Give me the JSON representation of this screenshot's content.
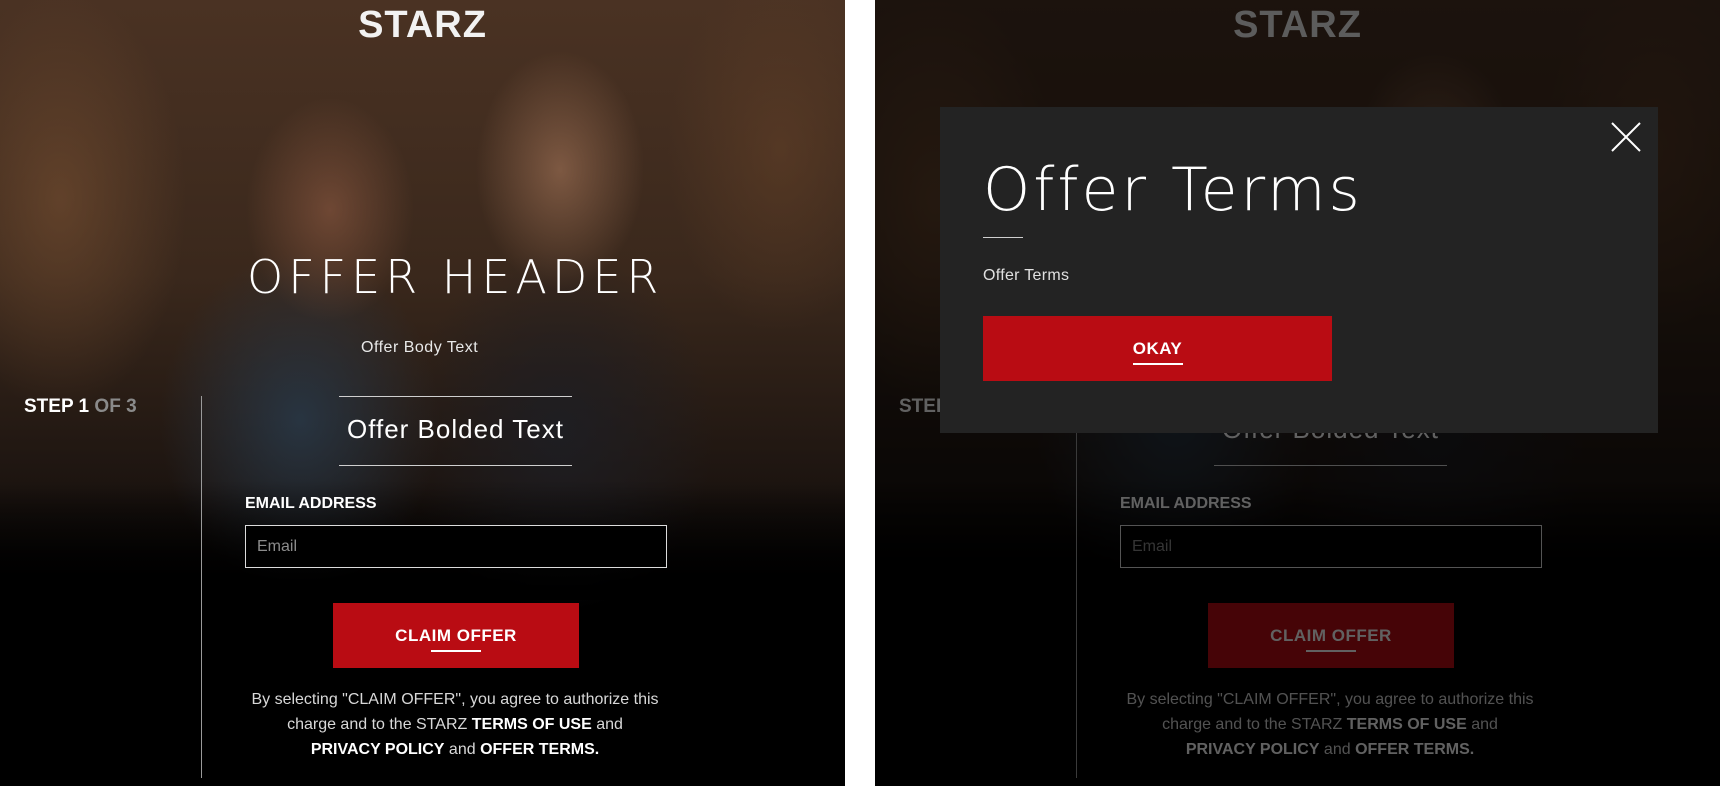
{
  "brand": {
    "logo_text": "STARZ",
    "accent_color": "#b90c13"
  },
  "offer": {
    "header": "OFFER HEADER",
    "body_text": "Offer Body Text",
    "bolded_text": "Offer Bolded Text"
  },
  "step": {
    "current": "STEP 1",
    "total": "OF 3"
  },
  "form": {
    "email_label": "EMAIL ADDRESS",
    "email_placeholder": "Email",
    "email_value": "",
    "claim_button": "CLAIM OFFER"
  },
  "legal": {
    "text_part1": "By selecting \"CLAIM OFFER\", you agree to authorize this charge and to the STARZ",
    "terms_of_use": "TERMS OF USE",
    "and1": "and",
    "privacy_policy": "PRIVACY POLICY",
    "and2": "and",
    "offer_terms": "OFFER TERMS."
  },
  "modal": {
    "title": "Offer Terms",
    "text": "Offer Terms",
    "okay_button": "OKAY",
    "close_icon": "close-icon"
  }
}
